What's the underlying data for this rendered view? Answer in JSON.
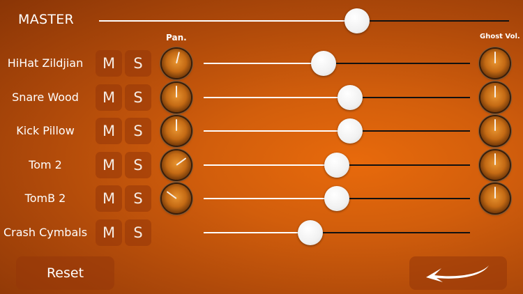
{
  "master": {
    "label": "MASTER",
    "level": 0.63
  },
  "headers": {
    "pan": "Pan.",
    "ghost": "Ghost Vol."
  },
  "buttons": {
    "mute": "M",
    "solo": "S",
    "reset": "Reset",
    "back_icon": "back-arrow-icon"
  },
  "tracks": [
    {
      "name": "HiHat Zildjian",
      "volume": 0.45,
      "pan": 0.55,
      "ghost": 0.5
    },
    {
      "name": "Snare Wood",
      "volume": 0.55,
      "pan": 0.5,
      "ghost": 0.5
    },
    {
      "name": "Kick Pillow",
      "volume": 0.55,
      "pan": 0.5,
      "ghost": 0.5
    },
    {
      "name": "Tom 2",
      "volume": 0.5,
      "pan": 0.7,
      "ghost": 0.5
    },
    {
      "name": "TomB 2",
      "volume": 0.5,
      "pan": 0.3,
      "ghost": 0.5
    },
    {
      "name": "Crash Cymbals",
      "volume": 0.4,
      "pan": null,
      "ghost": null
    }
  ],
  "colors": {
    "background": "#d25e0c",
    "slider_filled": "#ffffff",
    "slider_empty": "#111111",
    "knob": "#c46a14"
  }
}
